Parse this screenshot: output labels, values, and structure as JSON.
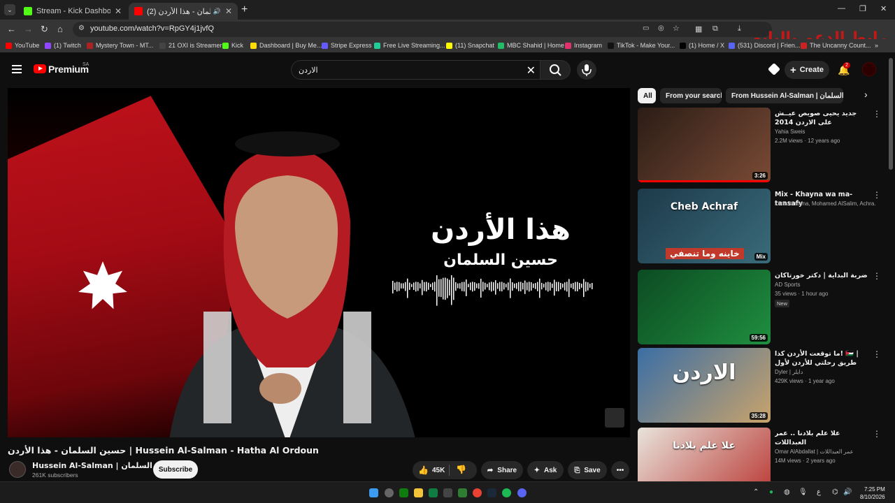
{
  "browser": {
    "tabs": [
      {
        "title": "Stream - Kick Dashboard",
        "close": "✕"
      },
      {
        "title": "(2) حسين السلمان - هذا الأردن",
        "close": "✕"
      }
    ],
    "new_tab": "+",
    "url": "youtube.com/watch?v=RpGY4j1jvfQ",
    "overlay_text": "رابط الدعم بالبايو",
    "window_controls": [
      "—",
      "❐",
      "✕"
    ]
  },
  "bookmarks": [
    {
      "label": "YouTube",
      "color": "#ff0000"
    },
    {
      "label": "(1) Twitch",
      "color": "#9146ff"
    },
    {
      "label": "Mystery Town - MT...",
      "color": "#aa2222"
    },
    {
      "label": "21 OXI is Streamer",
      "color": "#444444"
    },
    {
      "label": "Kick",
      "color": "#53fc18"
    },
    {
      "label": "Dashboard | Buy Me...",
      "color": "#ffdd00"
    },
    {
      "label": "Stripe Express",
      "color": "#635bff"
    },
    {
      "label": "Free Live Streaming...",
      "color": "#22cc99"
    },
    {
      "label": "(11) Snapchat",
      "color": "#fffc00"
    },
    {
      "label": "MBC Shahid | Home",
      "color": "#22bb66"
    },
    {
      "label": "Instagram",
      "color": "#e1306c"
    },
    {
      "label": "TikTok - Make Your...",
      "color": "#111111"
    },
    {
      "label": "(1) Home / X",
      "color": "#000000"
    },
    {
      "label": "(531) Discord | Frien...",
      "color": "#5865f2"
    },
    {
      "label": "The Uncanny Count...",
      "color": "#cc2222"
    }
  ],
  "masthead": {
    "logo_text": "Premium",
    "country": "SA",
    "search_value": "الاردن",
    "create_label": "Create",
    "notification_count": "2"
  },
  "player": {
    "song_title_ar": "هذا الأردن",
    "artist_ar": "حسين السلمان"
  },
  "video": {
    "title": "حسين السلمان - هذا الأردن | Hussein Al-Salman - Hatha Al Ordoun",
    "channel": "Hussein Al-Salman | حسين السلمان",
    "subscribers": "261K subscribers",
    "subscribe_label": "Subscribe",
    "likes": "45K",
    "share_label": "Share",
    "ask_label": "Ask",
    "save_label": "Save"
  },
  "chips": [
    {
      "label": "All"
    },
    {
      "label": "From your search"
    },
    {
      "label": "From Hussein Al-Salman | حسين السلمان"
    }
  ],
  "recommendations": [
    {
      "title": "جديد يحيى صويص عيــش على الاردن 2014",
      "channel": "Yahia Sweis",
      "meta": "2.2M views · 12 years ago",
      "duration": "3:26",
      "thumb_colors": [
        "#2b1d16",
        "#7a4a35"
      ],
      "progress": 1
    },
    {
      "title": "Mix - Khayna wa ma-tansafy",
      "channel": "Lotfi Jormena, Mohamed AlSalim, Achra...",
      "meta": "",
      "duration": "Mix",
      "thumb_colors": [
        "#1d3a4a",
        "#3a6b7a"
      ],
      "thumb_title": "Cheb Achraf",
      "thumb_sub": "خاينه وما تنصفي"
    },
    {
      "title": "ضربة البداية | دكتر خورتاكان",
      "channel": "AD Sports",
      "meta": "35 views · 1 hour ago",
      "badge": "New",
      "duration": "59:56",
      "thumb_colors": [
        "#0c4b22",
        "#1f8f3f"
      ]
    },
    {
      "title": "ما توقعت الأردن كذا! 🇯🇴 | طريق رحلتي للأردن لأول مرة!",
      "channel": "Dyler | دايلر",
      "meta": "429K views · 1 year ago",
      "duration": "35:28",
      "thumb_colors": [
        "#3a6ea5",
        "#c9a36b"
      ],
      "thumb_title": "الاردن"
    },
    {
      "title": "علا علم بلادنا .. عمر العبداللات",
      "channel": "Omar AlAbdallat | عمر العبداللات",
      "meta": "14M views · 2 years ago",
      "duration": "",
      "thumb_colors": [
        "#e8e4dc",
        "#b9342f"
      ],
      "thumb_title": "علا علم بلادنا"
    }
  ],
  "taskbar": {
    "time": "7:25 PM",
    "date": "8/10/2026"
  }
}
